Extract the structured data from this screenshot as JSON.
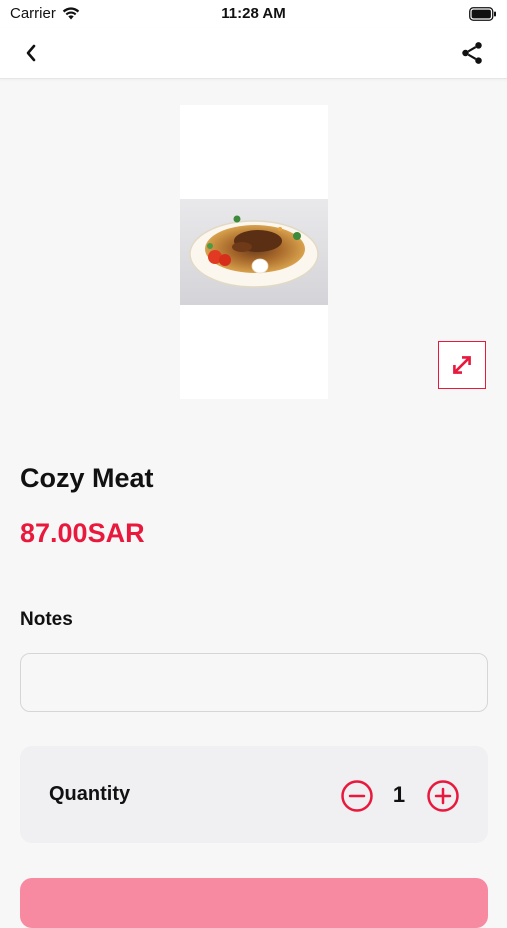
{
  "status_bar": {
    "carrier": "Carrier",
    "time": "11:28 AM"
  },
  "nav": {
    "back_icon": "chevron-left-icon",
    "share_icon": "share-icon"
  },
  "product": {
    "name": "Cozy Meat",
    "price": "87.00SAR",
    "image": "plate-of-noodles-with-meat",
    "expand_icon": "expand-arrows-icon"
  },
  "notes": {
    "label": "Notes",
    "value": "",
    "placeholder": ""
  },
  "quantity": {
    "label": "Quantity",
    "value": "1",
    "minus_icon": "minus-circle-icon",
    "plus_icon": "plus-circle-icon"
  },
  "colors": {
    "accent": "#e8193c",
    "button_bg": "#f78aa0",
    "page_bg": "#f7f7f8"
  }
}
